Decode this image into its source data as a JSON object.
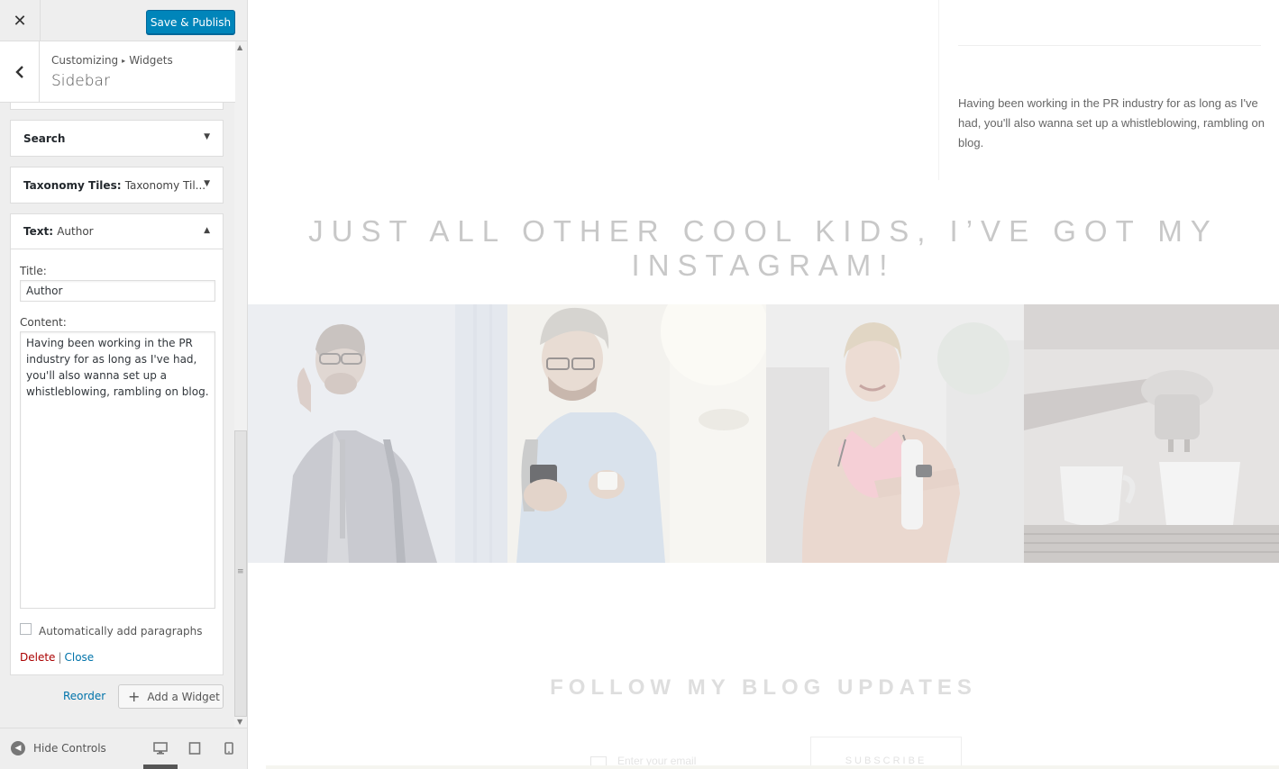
{
  "header": {
    "close_glyph": "✕",
    "save_label": "Save & Publish",
    "accent_color": "#0085ba"
  },
  "section": {
    "back_glyph": "‹",
    "breadcrumb_root": "Customizing",
    "breadcrumb_sep": "▸",
    "breadcrumb_current": "Widgets",
    "title": "Sidebar"
  },
  "widgets": [
    {
      "title": "Search",
      "subtitle": "",
      "arrow": "▼",
      "expanded": false
    },
    {
      "title": "Taxonomy Tiles",
      "subtitle": "Taxonomy Til...",
      "arrow": "▼",
      "expanded": false
    },
    {
      "title": "Text",
      "subtitle": "Author",
      "arrow": "▲",
      "expanded": true
    }
  ],
  "text_widget": {
    "title_label": "Title:",
    "title_value": "Author",
    "content_label": "Content:",
    "content_value": "Having been working in the PR industry for as long as I've had, you'll also wanna set up a whistleblowing, rambling on blog.",
    "autop_label": "Automatically add paragraphs",
    "autop_checked": false,
    "delete_label": "Delete",
    "separator": "|",
    "close_label": "Close"
  },
  "widget_actions": {
    "reorder_label": "Reorder",
    "add_label": "Add a Widget",
    "add_glyph": "+"
  },
  "footer": {
    "hide_label": "Hide Controls",
    "devices": [
      "desktop-icon",
      "tablet-icon",
      "mobile-icon"
    ],
    "active_device": "desktop"
  },
  "preview": {
    "author_text": "Having been working in the PR industry for as long as I've had, you'll also wanna set up a whistleblowing, rambling on blog.",
    "instagram_heading": "JUST ALL OTHER COOL KIDS, I’VE GOT MY INSTAGRAM!",
    "instagram_photos": [
      "businessman-on-phone",
      "man-with-smartphone",
      "woman-athlete",
      "espresso-machine"
    ],
    "blog_heading": "FOLLOW MY BLOG UPDATES",
    "email_placeholder": "Enter your email",
    "subscribe_label": "SUBSCRIBE"
  }
}
